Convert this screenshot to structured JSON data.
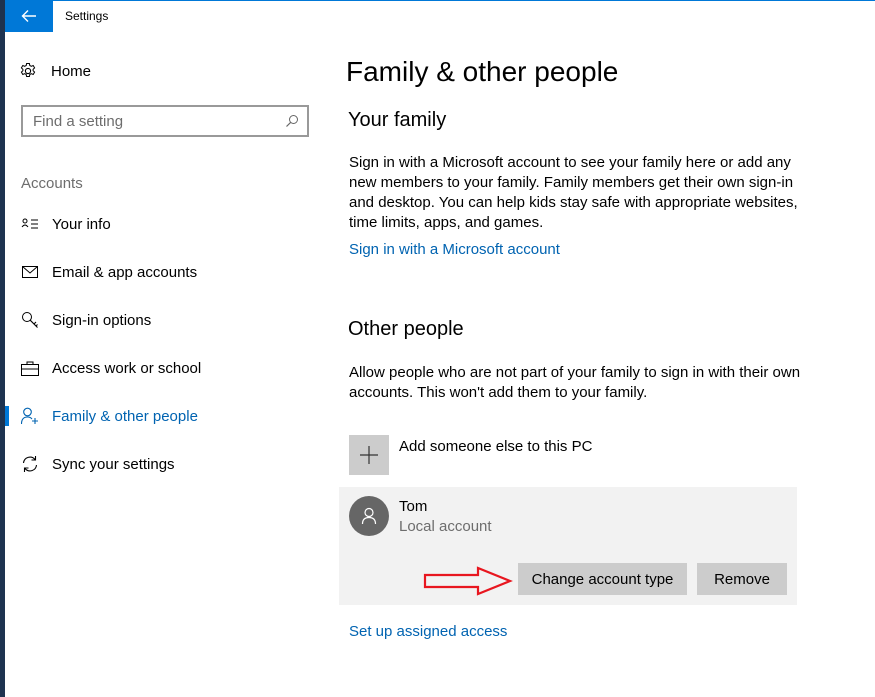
{
  "window": {
    "title": "Settings"
  },
  "sidebar": {
    "home_label": "Home",
    "search_placeholder": "Find a setting",
    "section_label": "Accounts",
    "items": [
      {
        "label": "Your info",
        "icon": "contact-card-icon"
      },
      {
        "label": "Email & app accounts",
        "icon": "mail-icon"
      },
      {
        "label": "Sign-in options",
        "icon": "key-icon"
      },
      {
        "label": "Access work or school",
        "icon": "briefcase-icon"
      },
      {
        "label": "Family & other people",
        "icon": "add-person-icon",
        "active": true
      },
      {
        "label": "Sync your settings",
        "icon": "sync-icon"
      }
    ]
  },
  "main": {
    "title": "Family & other people",
    "family": {
      "heading": "Your family",
      "description": "Sign in with a Microsoft account to see your family here or add any new members to your family. Family members get their own sign-in and desktop. You can help kids stay safe with appropriate websites, time limits, apps, and games.",
      "link": "Sign in with a Microsoft account"
    },
    "other": {
      "heading": "Other people",
      "description": "Allow people who are not part of your family to sign in with their own accounts. This won't add them to your family.",
      "add_label": "Add someone else to this PC",
      "user": {
        "name": "Tom",
        "type": "Local account",
        "change_button": "Change account type",
        "remove_button": "Remove"
      }
    },
    "assigned_access_link": "Set up assigned access"
  },
  "colors": {
    "accent": "#0078d7",
    "link": "#0063b1",
    "annotation": "#e8161f"
  }
}
